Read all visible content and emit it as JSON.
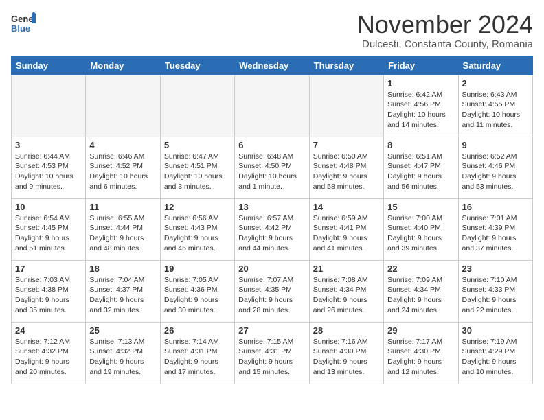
{
  "header": {
    "logo_general": "General",
    "logo_blue": "Blue",
    "month_title": "November 2024",
    "subtitle": "Dulcesti, Constanta County, Romania"
  },
  "weekdays": [
    "Sunday",
    "Monday",
    "Tuesday",
    "Wednesday",
    "Thursday",
    "Friday",
    "Saturday"
  ],
  "weeks": [
    [
      {
        "day": "",
        "info": ""
      },
      {
        "day": "",
        "info": ""
      },
      {
        "day": "",
        "info": ""
      },
      {
        "day": "",
        "info": ""
      },
      {
        "day": "",
        "info": ""
      },
      {
        "day": "1",
        "info": "Sunrise: 6:42 AM\nSunset: 4:56 PM\nDaylight: 10 hours\nand 14 minutes."
      },
      {
        "day": "2",
        "info": "Sunrise: 6:43 AM\nSunset: 4:55 PM\nDaylight: 10 hours\nand 11 minutes."
      }
    ],
    [
      {
        "day": "3",
        "info": "Sunrise: 6:44 AM\nSunset: 4:53 PM\nDaylight: 10 hours\nand 9 minutes."
      },
      {
        "day": "4",
        "info": "Sunrise: 6:46 AM\nSunset: 4:52 PM\nDaylight: 10 hours\nand 6 minutes."
      },
      {
        "day": "5",
        "info": "Sunrise: 6:47 AM\nSunset: 4:51 PM\nDaylight: 10 hours\nand 3 minutes."
      },
      {
        "day": "6",
        "info": "Sunrise: 6:48 AM\nSunset: 4:50 PM\nDaylight: 10 hours\nand 1 minute."
      },
      {
        "day": "7",
        "info": "Sunrise: 6:50 AM\nSunset: 4:48 PM\nDaylight: 9 hours\nand 58 minutes."
      },
      {
        "day": "8",
        "info": "Sunrise: 6:51 AM\nSunset: 4:47 PM\nDaylight: 9 hours\nand 56 minutes."
      },
      {
        "day": "9",
        "info": "Sunrise: 6:52 AM\nSunset: 4:46 PM\nDaylight: 9 hours\nand 53 minutes."
      }
    ],
    [
      {
        "day": "10",
        "info": "Sunrise: 6:54 AM\nSunset: 4:45 PM\nDaylight: 9 hours\nand 51 minutes."
      },
      {
        "day": "11",
        "info": "Sunrise: 6:55 AM\nSunset: 4:44 PM\nDaylight: 9 hours\nand 48 minutes."
      },
      {
        "day": "12",
        "info": "Sunrise: 6:56 AM\nSunset: 4:43 PM\nDaylight: 9 hours\nand 46 minutes."
      },
      {
        "day": "13",
        "info": "Sunrise: 6:57 AM\nSunset: 4:42 PM\nDaylight: 9 hours\nand 44 minutes."
      },
      {
        "day": "14",
        "info": "Sunrise: 6:59 AM\nSunset: 4:41 PM\nDaylight: 9 hours\nand 41 minutes."
      },
      {
        "day": "15",
        "info": "Sunrise: 7:00 AM\nSunset: 4:40 PM\nDaylight: 9 hours\nand 39 minutes."
      },
      {
        "day": "16",
        "info": "Sunrise: 7:01 AM\nSunset: 4:39 PM\nDaylight: 9 hours\nand 37 minutes."
      }
    ],
    [
      {
        "day": "17",
        "info": "Sunrise: 7:03 AM\nSunset: 4:38 PM\nDaylight: 9 hours\nand 35 minutes."
      },
      {
        "day": "18",
        "info": "Sunrise: 7:04 AM\nSunset: 4:37 PM\nDaylight: 9 hours\nand 32 minutes."
      },
      {
        "day": "19",
        "info": "Sunrise: 7:05 AM\nSunset: 4:36 PM\nDaylight: 9 hours\nand 30 minutes."
      },
      {
        "day": "20",
        "info": "Sunrise: 7:07 AM\nSunset: 4:35 PM\nDaylight: 9 hours\nand 28 minutes."
      },
      {
        "day": "21",
        "info": "Sunrise: 7:08 AM\nSunset: 4:34 PM\nDaylight: 9 hours\nand 26 minutes."
      },
      {
        "day": "22",
        "info": "Sunrise: 7:09 AM\nSunset: 4:34 PM\nDaylight: 9 hours\nand 24 minutes."
      },
      {
        "day": "23",
        "info": "Sunrise: 7:10 AM\nSunset: 4:33 PM\nDaylight: 9 hours\nand 22 minutes."
      }
    ],
    [
      {
        "day": "24",
        "info": "Sunrise: 7:12 AM\nSunset: 4:32 PM\nDaylight: 9 hours\nand 20 minutes."
      },
      {
        "day": "25",
        "info": "Sunrise: 7:13 AM\nSunset: 4:32 PM\nDaylight: 9 hours\nand 19 minutes."
      },
      {
        "day": "26",
        "info": "Sunrise: 7:14 AM\nSunset: 4:31 PM\nDaylight: 9 hours\nand 17 minutes."
      },
      {
        "day": "27",
        "info": "Sunrise: 7:15 AM\nSunset: 4:31 PM\nDaylight: 9 hours\nand 15 minutes."
      },
      {
        "day": "28",
        "info": "Sunrise: 7:16 AM\nSunset: 4:30 PM\nDaylight: 9 hours\nand 13 minutes."
      },
      {
        "day": "29",
        "info": "Sunrise: 7:17 AM\nSunset: 4:30 PM\nDaylight: 9 hours\nand 12 minutes."
      },
      {
        "day": "30",
        "info": "Sunrise: 7:19 AM\nSunset: 4:29 PM\nDaylight: 9 hours\nand 10 minutes."
      }
    ]
  ]
}
